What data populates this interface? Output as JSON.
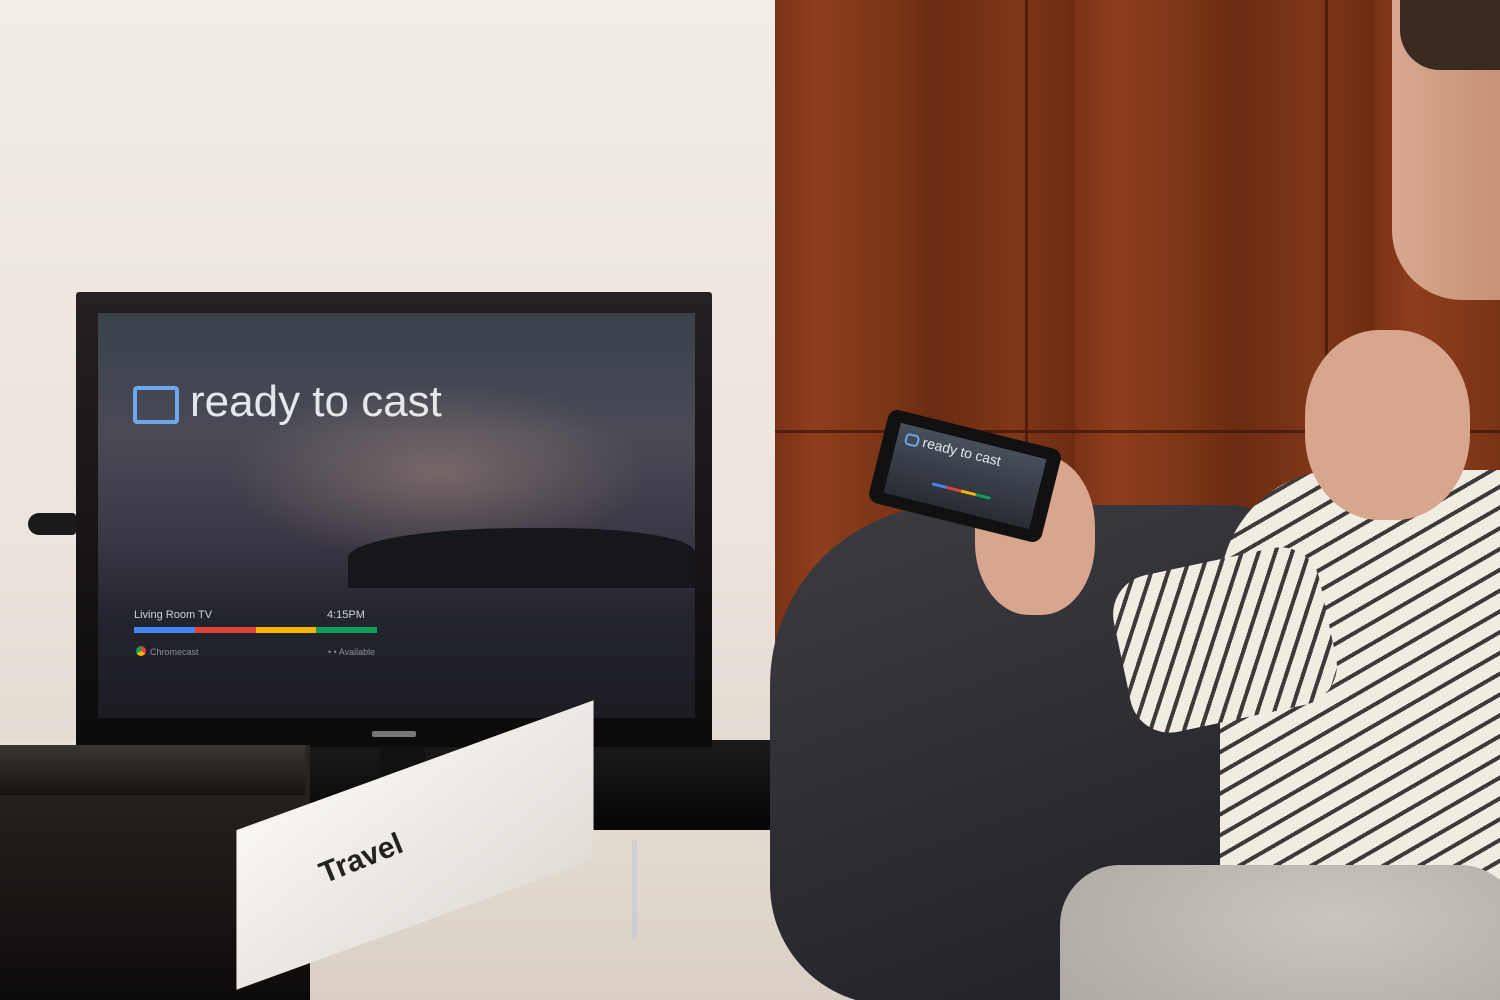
{
  "tv_screen": {
    "headline": "ready to cast",
    "device_name": "Living Room TV",
    "time": "4:15PM",
    "sub_left": "Chromecast",
    "sub_right": "• • Available",
    "progress_colors": [
      "#4285f4",
      "#db4437",
      "#f4b400",
      "#0f9d58"
    ]
  },
  "phone_screen": {
    "headline": "ready to cast"
  },
  "magazine": {
    "cover_title": "Travel"
  },
  "colors": {
    "cast_icon": "#6ea7ee",
    "wood": "#8e3e1c",
    "wall": "#efe9e2"
  }
}
